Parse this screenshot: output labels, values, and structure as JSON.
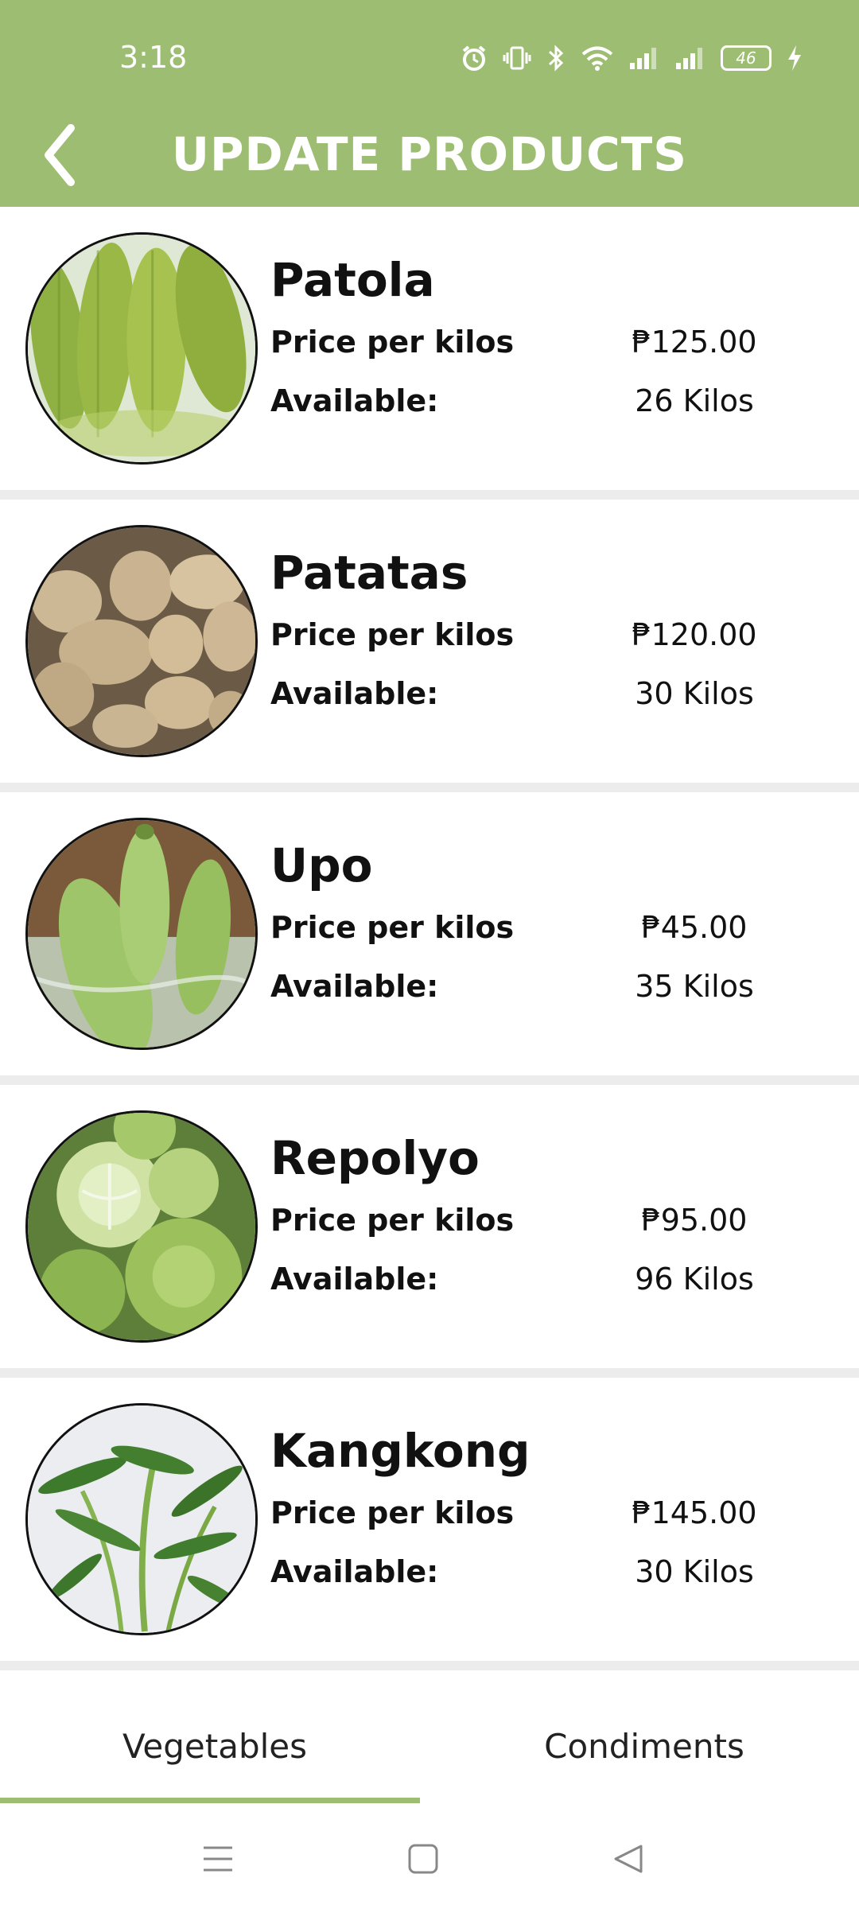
{
  "status_bar": {
    "time": "3:18",
    "battery": "46",
    "icons": [
      "alarm-icon",
      "vibrate-icon",
      "bluetooth-icon",
      "wifi-icon",
      "signal-icon",
      "signal-icon",
      "battery-icon",
      "charging-icon"
    ]
  },
  "header": {
    "title": "UPDATE PRODUCTS",
    "back_icon": "chevron-left-icon",
    "color": "#9dbd72"
  },
  "products": [
    {
      "name": "Patola",
      "price_label": "Price per kilos",
      "price": "₱125.00",
      "available_label": "Available:",
      "available": "26 Kilos"
    },
    {
      "name": "Patatas",
      "price_label": "Price per kilos",
      "price": "₱120.00",
      "available_label": "Available:",
      "available": "30 Kilos"
    },
    {
      "name": "Upo",
      "price_label": "Price per kilos",
      "price": "₱45.00",
      "available_label": "Available:",
      "available": "35 Kilos"
    },
    {
      "name": "Repolyo",
      "price_label": "Price per kilos",
      "price": "₱95.00",
      "available_label": "Available:",
      "available": "96 Kilos"
    },
    {
      "name": "Kangkong",
      "price_label": "Price per kilos",
      "price": "₱145.00",
      "available_label": "Available:",
      "available": "30 Kilos"
    }
  ],
  "tabs": [
    {
      "label": "Vegetables",
      "selected": true
    },
    {
      "label": "Condiments",
      "selected": false
    }
  ],
  "nav": {
    "buttons": [
      "menu-icon",
      "home-square-icon",
      "back-triangle-icon"
    ]
  }
}
